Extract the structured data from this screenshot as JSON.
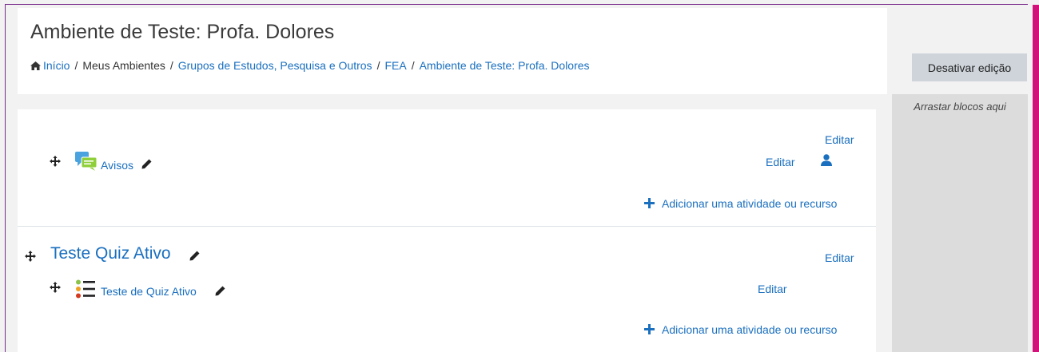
{
  "header": {
    "title": "Ambiente de Teste: Profa. Dolores",
    "breadcrumb": {
      "home": "Início",
      "my": "Meus Ambientes",
      "group": "Grupos de Estudos, Pesquisa e Outros",
      "fea": "FEA",
      "current": "Ambiente de Teste: Profa. Dolores"
    },
    "edit_toggle": "Desativar edição"
  },
  "blocks": {
    "drop_hint": "Arrastar blocos aqui"
  },
  "section0": {
    "section_edit": "Editar",
    "activity": {
      "name": "Avisos",
      "edit": "Editar"
    },
    "add_activity": "Adicionar uma atividade ou recurso"
  },
  "section1": {
    "title": "Teste Quiz Ativo",
    "section_edit": "Editar",
    "activity": {
      "name": "Teste de Quiz Ativo",
      "edit": "Editar"
    },
    "add_activity": "Adicionar uma atividade ou recurso"
  },
  "colors": {
    "link": "#1a6fbf",
    "accent_bar": "#d0137a",
    "frame": "#7a2d8c",
    "button_bg": "#ced4da"
  }
}
